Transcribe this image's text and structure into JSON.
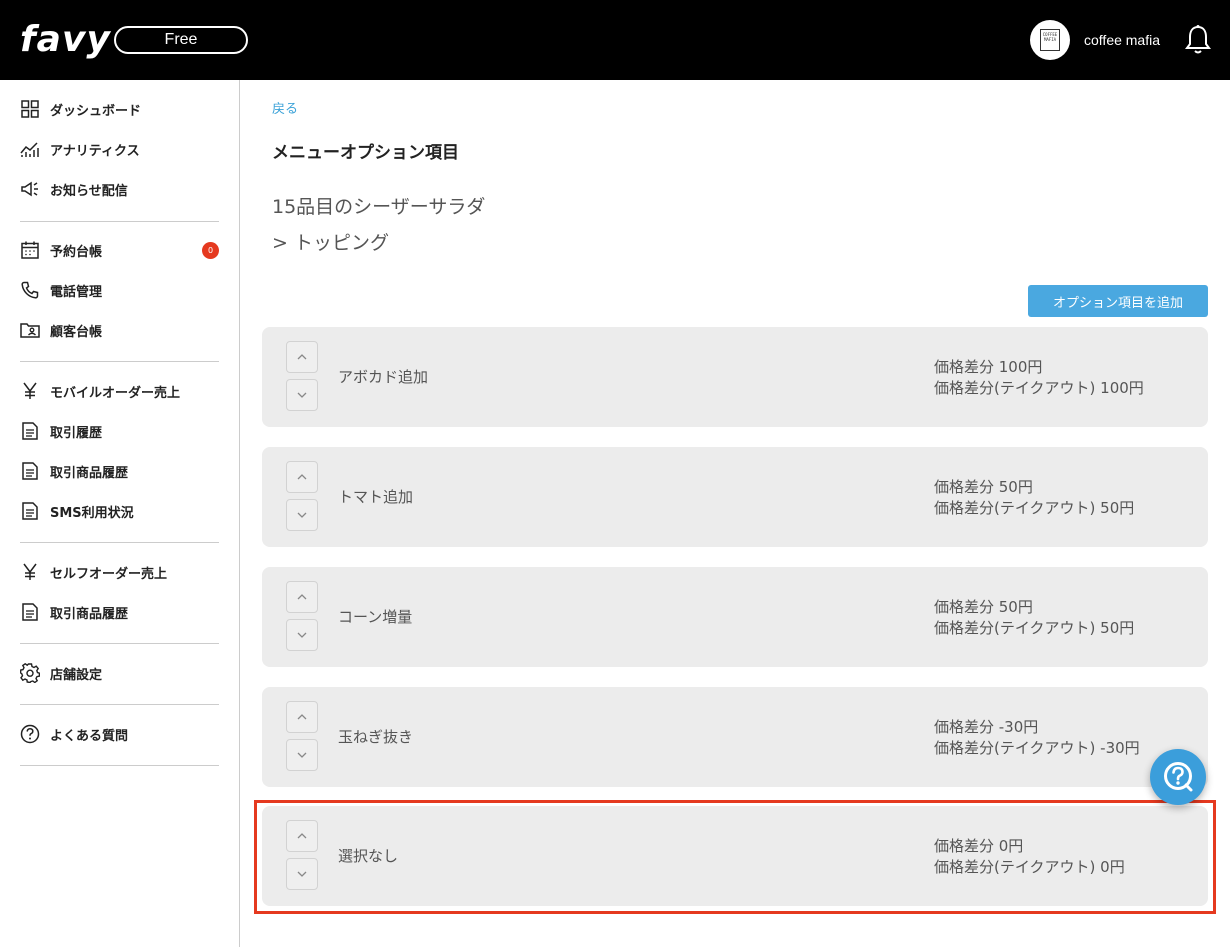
{
  "header": {
    "logo": "favy",
    "plan": "Free",
    "store_avatar_text": "COFFEE MAFIA",
    "store_name": "coffee mafia"
  },
  "sidebar": {
    "groups": [
      [
        {
          "label": "ダッシュボード",
          "icon": "dashboard-icon"
        },
        {
          "label": "アナリティクス",
          "icon": "analytics-icon"
        },
        {
          "label": "お知らせ配信",
          "icon": "megaphone-icon"
        }
      ],
      [
        {
          "label": "予約台帳",
          "icon": "calendar-icon",
          "badge": "0"
        },
        {
          "label": "電話管理",
          "icon": "phone-icon"
        },
        {
          "label": "顧客台帳",
          "icon": "customer-folder-icon"
        }
      ],
      [
        {
          "label": "モバイルオーダー売上",
          "icon": "yen-icon"
        },
        {
          "label": "取引履歴",
          "icon": "document-icon"
        },
        {
          "label": "取引商品履歴",
          "icon": "document-icon"
        },
        {
          "label": "SMS利用状況",
          "icon": "document-icon"
        }
      ],
      [
        {
          "label": "セルフオーダー売上",
          "icon": "yen-icon"
        },
        {
          "label": "取引商品履歴",
          "icon": "document-icon"
        }
      ],
      [
        {
          "label": "店舗設定",
          "icon": "gear-icon"
        }
      ],
      [
        {
          "label": "よくある質問",
          "icon": "question-icon"
        }
      ]
    ]
  },
  "main": {
    "back_label": "戻る",
    "page_title": "メニューオプション項目",
    "breadcrumb_item": "15品目のシーザーサラダ",
    "breadcrumb_option": "> トッピング",
    "add_button_label": "オプション項目を追加",
    "options": [
      {
        "name": "アボカド追加",
        "price": "価格差分 100円",
        "takeout_price": "価格差分(テイクアウト) 100円"
      },
      {
        "name": "トマト追加",
        "price": "価格差分 50円",
        "takeout_price": "価格差分(テイクアウト) 50円"
      },
      {
        "name": "コーン増量",
        "price": "価格差分 50円",
        "takeout_price": "価格差分(テイクアウト) 50円"
      },
      {
        "name": "玉ねぎ抜き",
        "price": "価格差分 -30円",
        "takeout_price": "価格差分(テイクアウト) -30円"
      },
      {
        "name": "選択なし",
        "price": "価格差分 0円",
        "takeout_price": "価格差分(テイクアウト) 0円"
      }
    ],
    "highlighted_option_index": 4
  },
  "colors": {
    "header_bg": "#000000",
    "accent": "#4aa8e0",
    "link": "#3ba2d8",
    "badge": "#e5391f",
    "highlight": "#e5391f",
    "card_bg": "#ececec"
  }
}
